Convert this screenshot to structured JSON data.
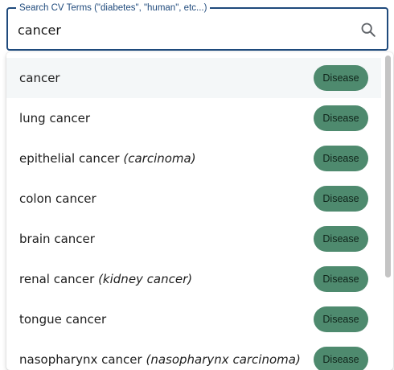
{
  "search": {
    "label": "Search CV Terms (\"diabetes\", \"human\", etc...)",
    "value": "cancer",
    "icon": "search-icon"
  },
  "options": [
    {
      "term": "cancer",
      "alias": "",
      "category": "Disease",
      "highlighted": true
    },
    {
      "term": "lung cancer",
      "alias": "",
      "category": "Disease"
    },
    {
      "term": "epithelial cancer",
      "alias": "(carcinoma)",
      "category": "Disease"
    },
    {
      "term": "colon cancer",
      "alias": "",
      "category": "Disease"
    },
    {
      "term": "brain cancer",
      "alias": "",
      "category": "Disease"
    },
    {
      "term": "renal cancer",
      "alias": "(kidney cancer)",
      "category": "Disease"
    },
    {
      "term": "tongue cancer",
      "alias": "",
      "category": "Disease"
    },
    {
      "term": "nasopharynx cancer",
      "alias": "(nasopharynx carcinoma)",
      "category": "Disease"
    }
  ],
  "colors": {
    "field_border": "#1f4a7c",
    "badge_background": "#4e8a6e",
    "highlight_row": "#f4f7f8"
  }
}
